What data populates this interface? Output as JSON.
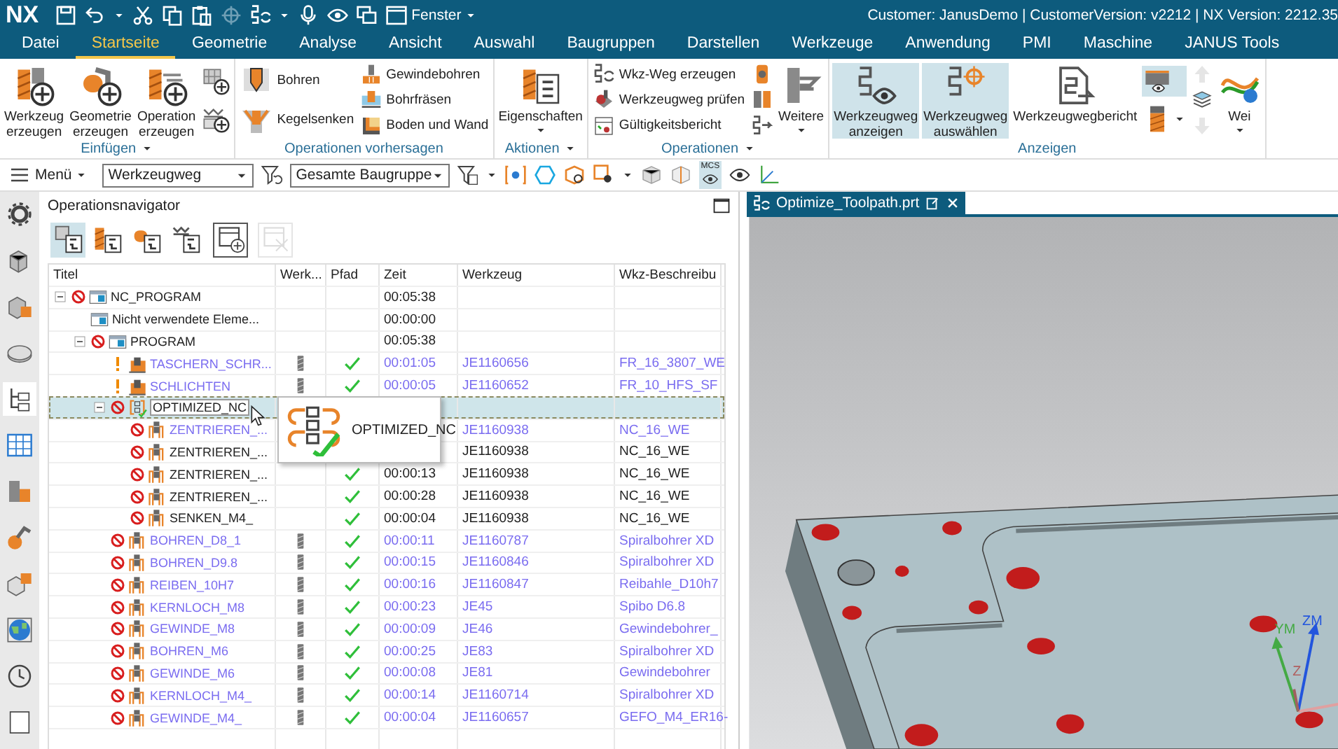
{
  "titlebar": {
    "logo": "NX",
    "window_menu": "Fenster",
    "info": "Customer: JanusDemo | CustomerVersion: v2212 | NX Version: 2212.35"
  },
  "menu_tabs": [
    {
      "label": "Datei",
      "selected": false
    },
    {
      "label": "Startseite",
      "selected": true
    },
    {
      "label": "Geometrie",
      "selected": false
    },
    {
      "label": "Analyse",
      "selected": false
    },
    {
      "label": "Ansicht",
      "selected": false
    },
    {
      "label": "Auswahl",
      "selected": false
    },
    {
      "label": "Baugruppen",
      "selected": false
    },
    {
      "label": "Darstellen",
      "selected": false
    },
    {
      "label": "Werkzeuge",
      "selected": false
    },
    {
      "label": "Anwendung",
      "selected": false
    },
    {
      "label": "PMI",
      "selected": false
    },
    {
      "label": "Maschine",
      "selected": false
    },
    {
      "label": "JANUS Tools",
      "selected": false
    }
  ],
  "ribbon": {
    "groups": [
      {
        "label": "Einfügen",
        "menu": true,
        "columns": [
          [
            {
              "kind": "large",
              "lines": [
                "Werkzeug",
                "erzeugen"
              ],
              "on": false,
              "disabled": false
            }
          ],
          [
            {
              "kind": "large",
              "lines": [
                "Geometrie",
                "erzeugen"
              ],
              "on": false,
              "disabled": false
            }
          ],
          [
            {
              "kind": "large",
              "lines": [
                "Operation",
                "erzeugen"
              ],
              "on": false,
              "disabled": false
            }
          ],
          [
            {
              "kind": "icon",
              "on": false,
              "disabled": false
            },
            {
              "kind": "icon",
              "on": false,
              "disabled": false
            }
          ]
        ]
      },
      {
        "label": "Operationen vorhersagen",
        "menu": false,
        "columns": [
          [
            {
              "kind": "small",
              "label": "Bohren",
              "on": false,
              "disabled": false
            },
            {
              "kind": "small",
              "label": "Kegelsenken",
              "on": false,
              "disabled": false
            }
          ],
          [
            {
              "kind": "small",
              "label": "Gewindebohren",
              "on": false,
              "disabled": false
            },
            {
              "kind": "small",
              "label": "Bohrfräsen",
              "on": false,
              "disabled": false
            },
            {
              "kind": "small",
              "label": "Boden und Wand",
              "on": false,
              "disabled": false
            }
          ]
        ]
      },
      {
        "label": "Aktionen",
        "menu": true,
        "columns": [
          [
            {
              "kind": "large",
              "lines": [
                "Eigenschaften"
              ],
              "on": false,
              "caret": true,
              "disabled": false
            }
          ]
        ]
      },
      {
        "label": "Operationen",
        "menu": true,
        "columns": [
          [
            {
              "kind": "small",
              "label": "Wkz-Weg erzeugen",
              "on": false,
              "disabled": false
            },
            {
              "kind": "small",
              "label": "Werkzeugweg prüfen",
              "on": false,
              "disabled": false
            },
            {
              "kind": "small",
              "label": "Gültigkeitsbericht",
              "on": false,
              "disabled": false
            }
          ],
          [
            {
              "kind": "icon",
              "on": false,
              "disabled": false
            },
            {
              "kind": "icon",
              "on": false,
              "disabled": false
            },
            {
              "kind": "icon",
              "on": false,
              "disabled": false
            }
          ],
          [
            {
              "kind": "large",
              "lines": [
                "Weitere"
              ],
              "on": false,
              "caret": true,
              "disabled": false
            }
          ]
        ]
      },
      {
        "label": "Anzeigen",
        "menu": false,
        "columns": [
          [
            {
              "kind": "large",
              "lines": [
                "Werkzeugweg",
                "anzeigen"
              ],
              "on": true,
              "disabled": false
            }
          ],
          [
            {
              "kind": "large",
              "lines": [
                "Werkzeugweg",
                "auswählen"
              ],
              "on": true,
              "disabled": false
            }
          ],
          [
            {
              "kind": "large",
              "lines": [
                "Werkzeugwegbericht"
              ],
              "on": false,
              "disabled": false
            }
          ],
          [
            {
              "kind": "icon",
              "on": true,
              "disabled": false
            },
            {
              "kind": "icon",
              "on": false,
              "caret": true,
              "disabled": false
            }
          ],
          [
            {
              "kind": "icon",
              "on": false,
              "disabled": true
            },
            {
              "kind": "icon",
              "on": false,
              "disabled": false
            },
            {
              "kind": "icon",
              "on": false,
              "disabled": true
            }
          ],
          [
            {
              "kind": "large",
              "lines": [
                "Wei"
              ],
              "on": false,
              "caret": true,
              "disabled": false
            }
          ]
        ]
      }
    ]
  },
  "toolbar": {
    "menu": "Menü",
    "type_filter": "Werkzeugweg",
    "scope": "Gesamte Baugruppe",
    "mcs_label": "MCS"
  },
  "resource_bar": [
    {
      "selected": false
    },
    {
      "selected": false
    },
    {
      "selected": false
    },
    {
      "selected": false
    },
    {
      "selected": true
    },
    {
      "selected": false
    },
    {
      "selected": false
    },
    {
      "selected": false
    },
    {
      "selected": false
    },
    {
      "selected": false
    },
    {
      "selected": false
    },
    {
      "selected": false
    }
  ],
  "navigator": {
    "title": "Operationsnavigator",
    "view_buttons": [
      {
        "kind": "view",
        "selected": true,
        "disabled": false
      },
      {
        "kind": "view",
        "selected": false,
        "disabled": false
      },
      {
        "kind": "view",
        "selected": false,
        "disabled": false
      },
      {
        "kind": "view",
        "selected": false,
        "disabled": false
      },
      {
        "kind": "window",
        "selected": false,
        "disabled": false
      },
      {
        "kind": "window",
        "selected": false,
        "disabled": true
      }
    ],
    "columns": [
      "Titel",
      "Werk...",
      "Pfad",
      "Zeit",
      "Werkzeug",
      "Wkz-Beschreibu"
    ],
    "tree": [
      {
        "title": "NC_PROGRAM",
        "kind": "program",
        "prohibited": true,
        "warning": false,
        "expanded": true,
        "selected": false,
        "outdated": false,
        "tool_icon": false,
        "path_ok": false,
        "time": "00:05:38",
        "children": [
          {
            "title": "Nicht verwendete Eleme...",
            "kind": "program",
            "prohibited": false,
            "warning": false,
            "selected": false,
            "outdated": false,
            "tool_icon": false,
            "path_ok": false,
            "time": "00:00:00"
          },
          {
            "title": "PROGRAM",
            "kind": "program",
            "prohibited": true,
            "warning": false,
            "expanded": true,
            "selected": false,
            "outdated": false,
            "tool_icon": false,
            "path_ok": false,
            "time": "00:05:38",
            "children": [
              {
                "title": "TASCHERN_SCHR...",
                "kind": "pocket",
                "prohibited": false,
                "warning": true,
                "selected": false,
                "outdated": true,
                "tool_icon": true,
                "path_ok": true,
                "time": "00:01:05",
                "tool": "JE1160656",
                "description": "FR_16_3807_WE"
              },
              {
                "title": "SCHLICHTEN",
                "kind": "pocket",
                "prohibited": false,
                "warning": true,
                "selected": false,
                "outdated": true,
                "tool_icon": true,
                "path_ok": true,
                "time": "00:00:05",
                "tool": "JE1160652",
                "description": "FR_10_HFS_SF"
              },
              {
                "title": "OPTIMIZED_NC",
                "kind": "group",
                "prohibited": true,
                "warning": false,
                "expanded": true,
                "selected": true,
                "outdated": false,
                "tool_icon": false,
                "path_ok": false,
                "children": [
                  {
                    "title": "ZENTRIEREN_...",
                    "kind": "operation",
                    "prohibited": true,
                    "warning": false,
                    "selected": false,
                    "outdated": true,
                    "tool_icon": false,
                    "path_ok": false,
                    "tool": "JE1160938",
                    "description": "NC_16_WE"
                  },
                  {
                    "title": "ZENTRIEREN_...",
                    "kind": "operation",
                    "prohibited": true,
                    "warning": false,
                    "selected": false,
                    "outdated": false,
                    "tool_icon": false,
                    "path_ok": false,
                    "tool": "JE1160938",
                    "description": "NC_16_WE"
                  },
                  {
                    "title": "ZENTRIEREN_...",
                    "kind": "operation",
                    "prohibited": true,
                    "warning": false,
                    "selected": false,
                    "outdated": false,
                    "tool_icon": false,
                    "path_ok": true,
                    "time": "00:00:13",
                    "tool": "JE1160938",
                    "description": "NC_16_WE"
                  },
                  {
                    "title": "ZENTRIEREN_...",
                    "kind": "operation",
                    "prohibited": true,
                    "warning": false,
                    "selected": false,
                    "outdated": false,
                    "tool_icon": false,
                    "path_ok": true,
                    "time": "00:00:28",
                    "tool": "JE1160938",
                    "description": "NC_16_WE"
                  },
                  {
                    "title": "SENKEN_M4_",
                    "kind": "operation",
                    "prohibited": true,
                    "warning": false,
                    "selected": false,
                    "outdated": false,
                    "tool_icon": false,
                    "path_ok": true,
                    "time": "00:00:04",
                    "tool": "JE1160938",
                    "description": "NC_16_WE"
                  }
                ]
              },
              {
                "title": "BOHREN_D8_1",
                "kind": "operation",
                "prohibited": true,
                "warning": false,
                "selected": false,
                "outdated": true,
                "tool_icon": true,
                "path_ok": true,
                "time": "00:00:11",
                "tool": "JE1160787",
                "description": "Spiralbohrer XD"
              },
              {
                "title": "BOHREN_D9.8",
                "kind": "operation",
                "prohibited": true,
                "warning": false,
                "selected": false,
                "outdated": true,
                "tool_icon": true,
                "path_ok": true,
                "time": "00:00:15",
                "tool": "JE1160846",
                "description": "Spiralbohrer XD"
              },
              {
                "title": "REIBEN_10H7",
                "kind": "operation",
                "prohibited": true,
                "warning": false,
                "selected": false,
                "outdated": true,
                "tool_icon": true,
                "path_ok": true,
                "time": "00:00:16",
                "tool": "JE1160847",
                "description": "Reibahle_D10h7"
              },
              {
                "title": "KERNLOCH_M8",
                "kind": "operation",
                "prohibited": true,
                "warning": false,
                "selected": false,
                "outdated": true,
                "tool_icon": true,
                "path_ok": true,
                "time": "00:00:23",
                "tool": "JE45",
                "description": "Spibo D6.8"
              },
              {
                "title": "GEWINDE_M8",
                "kind": "operation",
                "prohibited": true,
                "warning": false,
                "selected": false,
                "outdated": true,
                "tool_icon": true,
                "path_ok": true,
                "time": "00:00:09",
                "tool": "JE46",
                "description": "Gewindebohrer_"
              },
              {
                "title": "BOHREN_M6",
                "kind": "operation",
                "prohibited": true,
                "warning": false,
                "selected": false,
                "outdated": true,
                "tool_icon": true,
                "path_ok": true,
                "time": "00:00:25",
                "tool": "JE83",
                "description": "Spiralbohrer XD"
              },
              {
                "title": "GEWINDE_M6",
                "kind": "operation",
                "prohibited": true,
                "warning": false,
                "selected": false,
                "outdated": true,
                "tool_icon": true,
                "path_ok": true,
                "time": "00:00:08",
                "tool": "JE81",
                "description": "Gewindebohrer"
              },
              {
                "title": "KERNLOCH_M4_",
                "kind": "operation",
                "prohibited": true,
                "warning": false,
                "selected": false,
                "outdated": true,
                "tool_icon": true,
                "path_ok": true,
                "time": "00:00:14",
                "tool": "JE1160714",
                "description": "Spiralbohrer XD"
              },
              {
                "title": "GEWINDE_M4_",
                "kind": "operation",
                "prohibited": true,
                "warning": false,
                "selected": false,
                "outdated": true,
                "tool_icon": true,
                "path_ok": true,
                "time": "00:00:04",
                "tool": "JE1160657",
                "description": "GEFO_M4_ER16-"
              }
            ]
          }
        ]
      }
    ],
    "tooltip": {
      "text": "OPTIMIZED_NC"
    }
  },
  "view": {
    "tab": "Optimize_Toolpath.prt",
    "triad_labels": [
      {
        "text": "ZM",
        "color": "#2255dd"
      },
      {
        "text": "YM",
        "color": "#44aa44"
      },
      {
        "text": "Z",
        "color": "#b06060"
      }
    ]
  }
}
